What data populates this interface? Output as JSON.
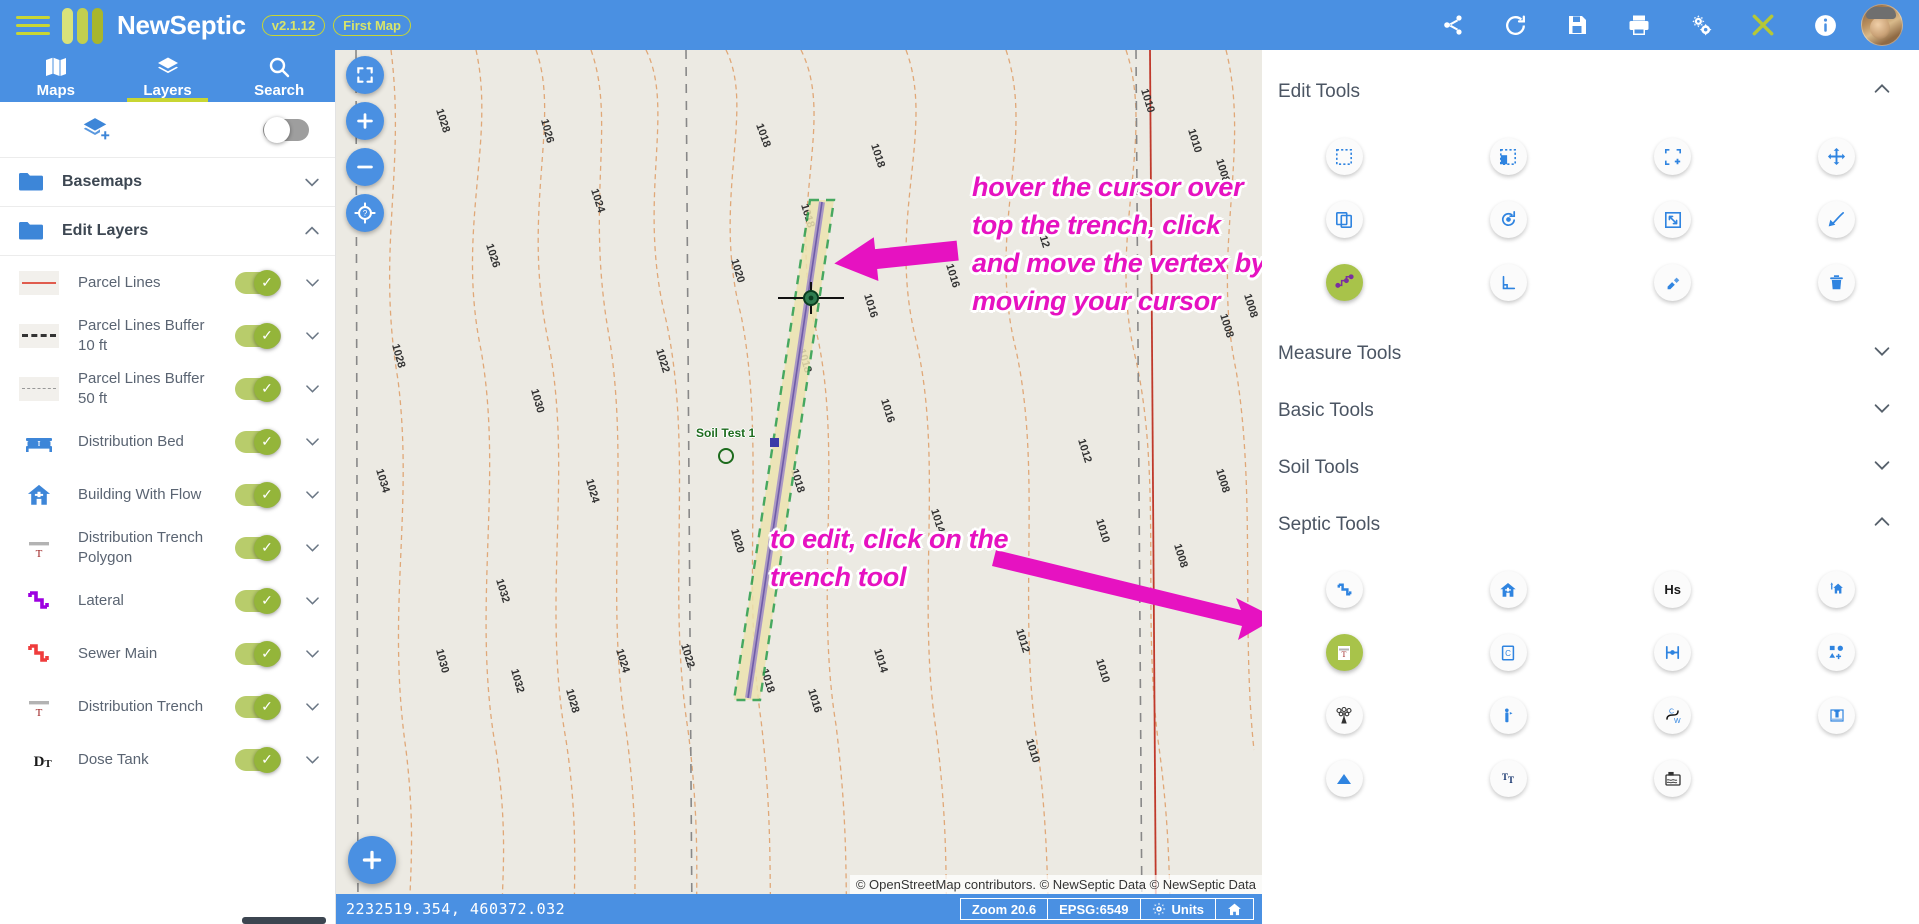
{
  "app": {
    "brand": "NewSeptic",
    "version_badge": "v2.1.12",
    "map_badge": "First Map",
    "menu_icon": "hamburger-icon",
    "logo_icon": "newseptic-logo-icon"
  },
  "topbar_icons": [
    {
      "name": "share-icon",
      "label": "Share"
    },
    {
      "name": "refresh-icon",
      "label": "Refresh"
    },
    {
      "name": "save-icon",
      "label": "Save"
    },
    {
      "name": "print-icon",
      "label": "Print"
    },
    {
      "name": "settings-gear-icon",
      "label": "Settings"
    },
    {
      "name": "tools-icon",
      "label": "Tools"
    },
    {
      "name": "info-icon",
      "label": "Info"
    }
  ],
  "left_panel": {
    "tabs": [
      {
        "label": "Maps",
        "icon": "map-icon",
        "active": false
      },
      {
        "label": "Layers",
        "icon": "layers-icon",
        "active": true
      },
      {
        "label": "Search",
        "icon": "search-icon",
        "active": false
      }
    ],
    "add_layer_icon": "add-layer-icon",
    "master_toggle_on": false,
    "folders": [
      {
        "label": "Basemaps",
        "expanded": false
      },
      {
        "label": "Edit Layers",
        "expanded": true
      }
    ],
    "layers": [
      {
        "label": "Parcel Lines",
        "symbol": "solid-red-line",
        "enabled": true
      },
      {
        "label": "Parcel Lines Buffer 10 ft",
        "symbol": "dashed-black-line",
        "enabled": true
      },
      {
        "label": "Parcel Lines Buffer 50 ft",
        "symbol": "dashed-gray-line",
        "enabled": true
      },
      {
        "label": "Distribution Bed",
        "symbol": "bed-icon",
        "enabled": true
      },
      {
        "label": "Building With Flow",
        "symbol": "home-icon",
        "enabled": true
      },
      {
        "label": "Distribution Trench Polygon",
        "symbol": "trench-t-icon",
        "enabled": true
      },
      {
        "label": "Lateral",
        "symbol": "purple-zigzag-icon",
        "enabled": true
      },
      {
        "label": "Sewer Main",
        "symbol": "red-zigzag-icon",
        "enabled": true
      },
      {
        "label": "Distribution Trench",
        "symbol": "trench-t-icon",
        "enabled": true
      },
      {
        "label": "Dose Tank",
        "symbol": "dose-tank-icon",
        "enabled": true
      }
    ]
  },
  "map": {
    "controls": [
      {
        "name": "fullscreen-icon",
        "label": "Full extent"
      },
      {
        "name": "zoom-in-icon",
        "label": "Zoom in"
      },
      {
        "name": "zoom-out-icon",
        "label": "Zoom out"
      },
      {
        "name": "locate-me-icon",
        "label": "My location"
      }
    ],
    "add_feature_label": "+",
    "attribution": "© OpenStreetMap contributors. © NewSeptic Data © NewSeptic Data",
    "feature_label": "Soil Test 1",
    "annotations": [
      {
        "id": "a1",
        "text": "hover the cursor over top the trench, click and move the vertex by moving your cursor"
      },
      {
        "id": "a2",
        "text": "to edit, click on the trench tool"
      }
    ],
    "status": {
      "coordinates": "2232519.354, 460372.032",
      "zoom": "Zoom 20.6",
      "epsg": "EPSG:6549",
      "units": "Units",
      "home_icon": "home-icon"
    }
  },
  "right_panel": {
    "sections": [
      {
        "title": "Edit Tools",
        "expanded": true
      },
      {
        "title": "Measure Tools",
        "expanded": false
      },
      {
        "title": "Basic Tools",
        "expanded": false
      },
      {
        "title": "Soil Tools",
        "expanded": false
      },
      {
        "title": "Septic Tools",
        "expanded": true
      }
    ],
    "edit_tools": [
      {
        "name": "select-box-icon",
        "active": false
      },
      {
        "name": "select-subtract-icon",
        "active": false
      },
      {
        "name": "select-add-icon",
        "active": false
      },
      {
        "name": "move-feature-icon",
        "active": false
      },
      {
        "name": "copy-feature-icon",
        "active": false
      },
      {
        "name": "rotate-feature-icon",
        "active": false
      },
      {
        "name": "scale-feature-icon",
        "active": false
      },
      {
        "name": "reshape-feature-icon",
        "active": false
      },
      {
        "name": "edit-vertex-icon",
        "active": true
      },
      {
        "name": "right-angle-icon",
        "active": false
      },
      {
        "name": "snap-icon",
        "active": false
      },
      {
        "name": "delete-feature-icon",
        "active": false
      }
    ],
    "septic_tools": [
      {
        "name": "sewer-main-icon",
        "label": "",
        "active": false
      },
      {
        "name": "building-icon",
        "label": "",
        "active": false
      },
      {
        "name": "house-soil-icon",
        "label": "Hs",
        "active": false
      },
      {
        "name": "add-building-icon",
        "label": "",
        "active": false
      },
      {
        "name": "trench-tool-icon",
        "label": "T",
        "active": true
      },
      {
        "name": "chamber-icon",
        "label": "C",
        "active": false
      },
      {
        "name": "bed-width-icon",
        "label": "",
        "active": false
      },
      {
        "name": "add-features-icon",
        "label": "",
        "active": false
      },
      {
        "name": "distribution-network-icon",
        "label": "",
        "active": false
      },
      {
        "name": "inspection-port-icon",
        "label": "",
        "active": false
      },
      {
        "name": "cw-pipe-icon",
        "label": "CW",
        "active": false
      },
      {
        "name": "pump-vault-icon",
        "label": "",
        "active": false
      },
      {
        "name": "triangle-marker-icon",
        "label": "",
        "active": false
      },
      {
        "name": "tank-text-icon",
        "label": "TT",
        "active": false
      },
      {
        "name": "septic-tank-icon",
        "label": "",
        "active": false
      }
    ]
  }
}
